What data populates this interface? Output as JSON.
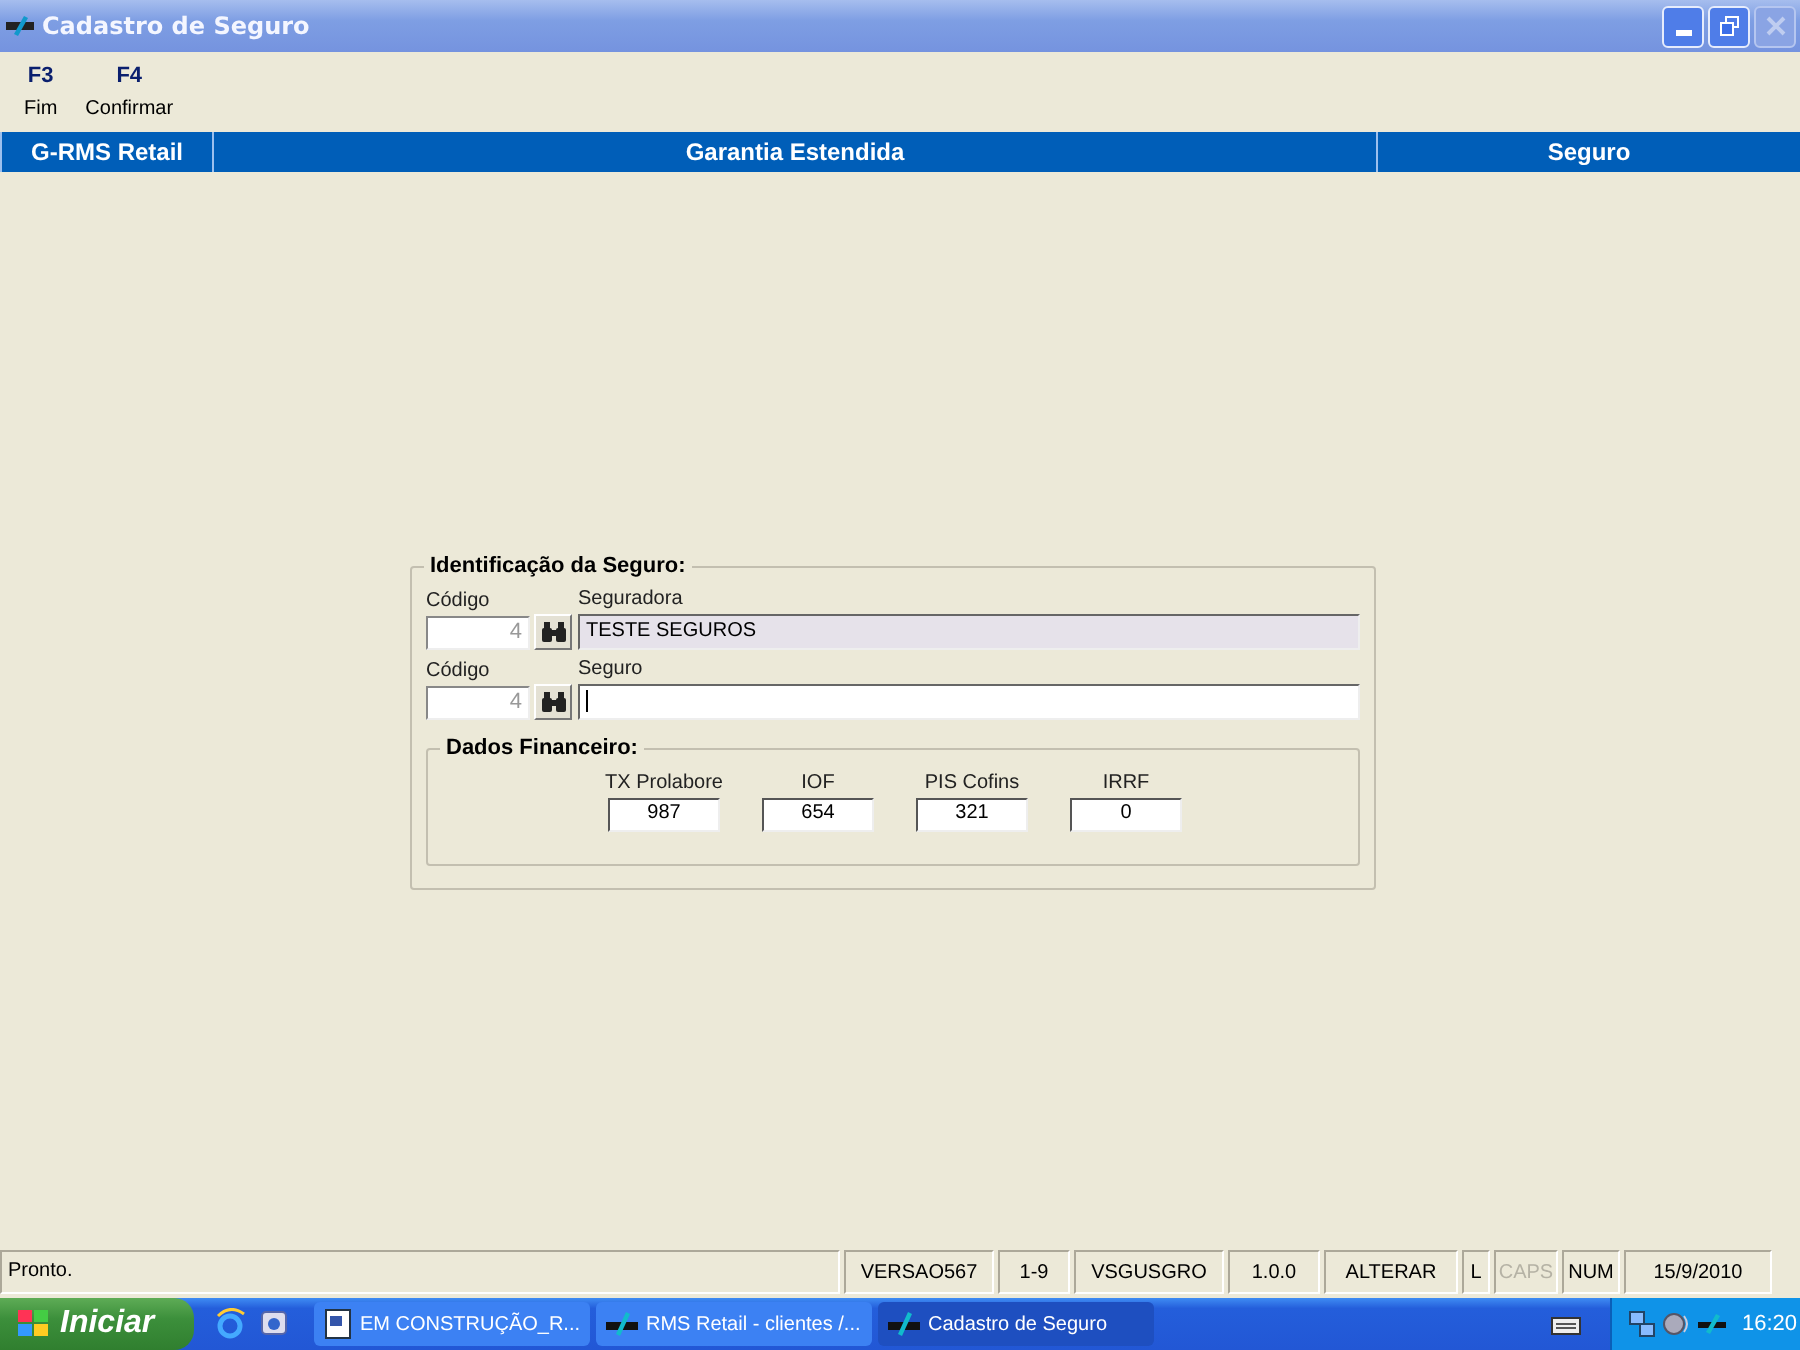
{
  "window": {
    "title": "Cadastro de Seguro",
    "close_disabled": true
  },
  "toolbar": [
    {
      "key": "F3",
      "label": "Fim"
    },
    {
      "key": "F4",
      "label": "Confirmar"
    }
  ],
  "header": [
    "G-RMS Retail",
    "Garantia Estendida",
    "Seguro"
  ],
  "identificacao": {
    "title": "Identificação da Seguro:",
    "rows": [
      {
        "code_label": "Código",
        "code_value": "4",
        "code_disabled": true,
        "name_label": "Seguradora",
        "name_value": "TESTE SEGUROS",
        "name_readonly": true
      },
      {
        "code_label": "Código",
        "code_value": "4",
        "code_disabled": true,
        "name_label": "Seguro",
        "name_readonly": false
      }
    ]
  },
  "dados_financeiro": {
    "title": "Dados Financeiro:",
    "fields": [
      {
        "label": "TX Prolabore",
        "value": "987"
      },
      {
        "label": "IOF",
        "value": "654"
      },
      {
        "label": "PIS Cofins",
        "value": "321"
      },
      {
        "label": "IRRF",
        "value": "0"
      }
    ]
  },
  "status_bar": {
    "message": "Pronto.",
    "panels": [
      {
        "text": "VERSAO567",
        "disabled": false
      },
      {
        "text": "1-9",
        "disabled": false
      },
      {
        "text": "VSGUSGRO",
        "disabled": false
      },
      {
        "text": "1.0.0",
        "disabled": false
      },
      {
        "text": "ALTERAR",
        "disabled": false
      },
      {
        "text": "L",
        "disabled": false
      },
      {
        "text": "CAPS",
        "disabled": true
      },
      {
        "text": "NUM",
        "disabled": false
      },
      {
        "text": "15/9/2010",
        "disabled": false
      }
    ]
  },
  "taskbar": {
    "start": "Iniciar",
    "buttons": [
      {
        "label": "EM CONSTRUÇÃO_R...",
        "kind": "document",
        "selected": false
      },
      {
        "label": "RMS Retail - clientes /...",
        "kind": "app",
        "selected": false
      },
      {
        "label": "Cadastro de Seguro",
        "kind": "app",
        "selected": true
      }
    ],
    "clock": "16:20"
  }
}
